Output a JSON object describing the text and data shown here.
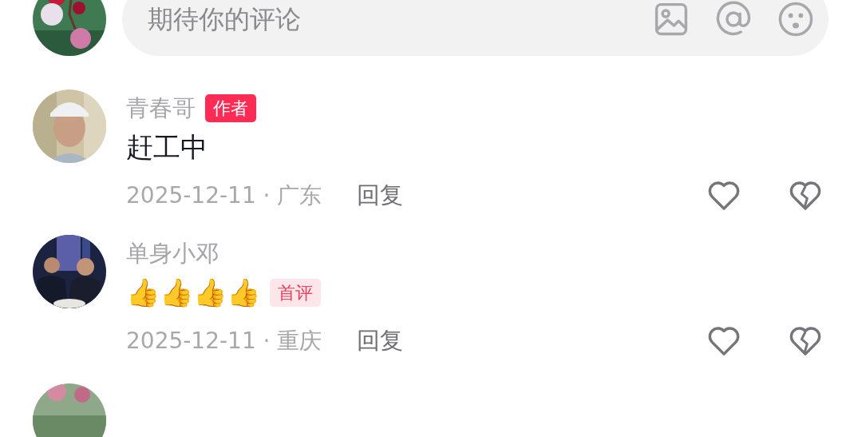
{
  "composer": {
    "placeholder": "期待你的评论"
  },
  "comments": [
    {
      "author": "青春哥",
      "badge": {
        "text": "作者",
        "kind": "author"
      },
      "content": "赶工中",
      "meta": "2025-12-11 · 广东",
      "reply": "回复",
      "liked": false,
      "disliked": false
    },
    {
      "author": "单身小邓",
      "content": "👍👍👍👍",
      "tag": {
        "text": "首评",
        "kind": "first"
      },
      "meta": "2025-12-11 · 重庆",
      "reply": "回复",
      "liked": false,
      "disliked": false
    }
  ]
}
